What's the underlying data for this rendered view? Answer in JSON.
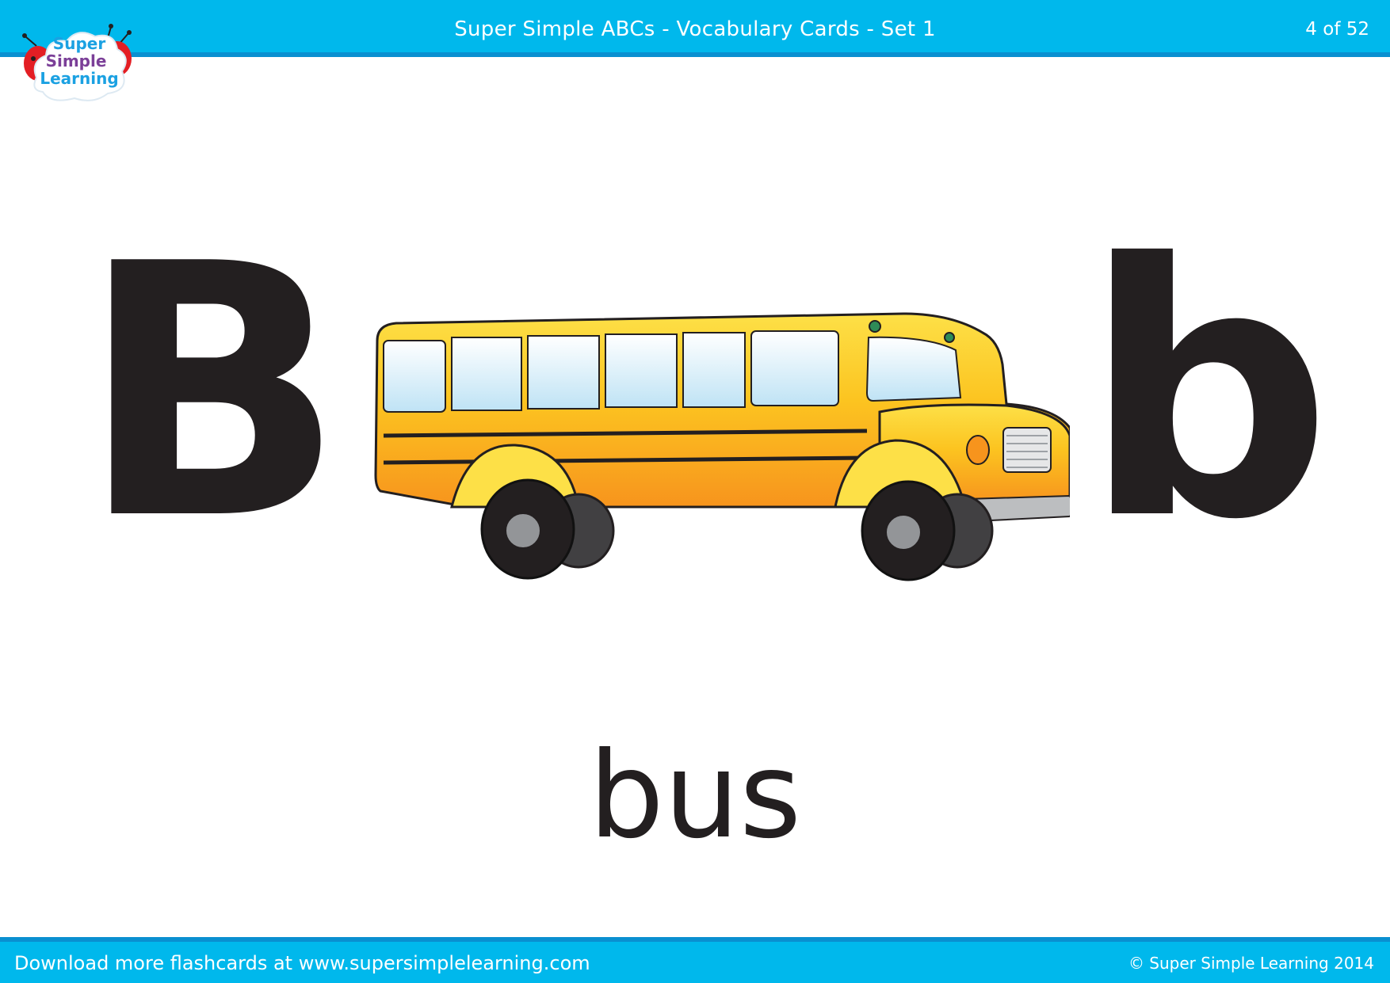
{
  "header": {
    "title": "Super Simple ABCs - Vocabulary Cards - Set 1",
    "page_indicator": "4 of 52"
  },
  "logo": {
    "line1": "Super",
    "line2": "Simple",
    "line3": "Learning"
  },
  "card": {
    "uppercase": "B",
    "lowercase": "b",
    "word": "bus",
    "illustration": "school-bus"
  },
  "footer": {
    "download_text": "Download more flashcards at www.supersimplelearning.com",
    "copyright": "© Super Simple Learning 2014"
  },
  "colors": {
    "bar": "#00b8ec",
    "bar_edge": "#0a8fd0",
    "letter": "#231f20",
    "bus_yellow": "#fcc420",
    "bus_orange": "#f7941d"
  }
}
